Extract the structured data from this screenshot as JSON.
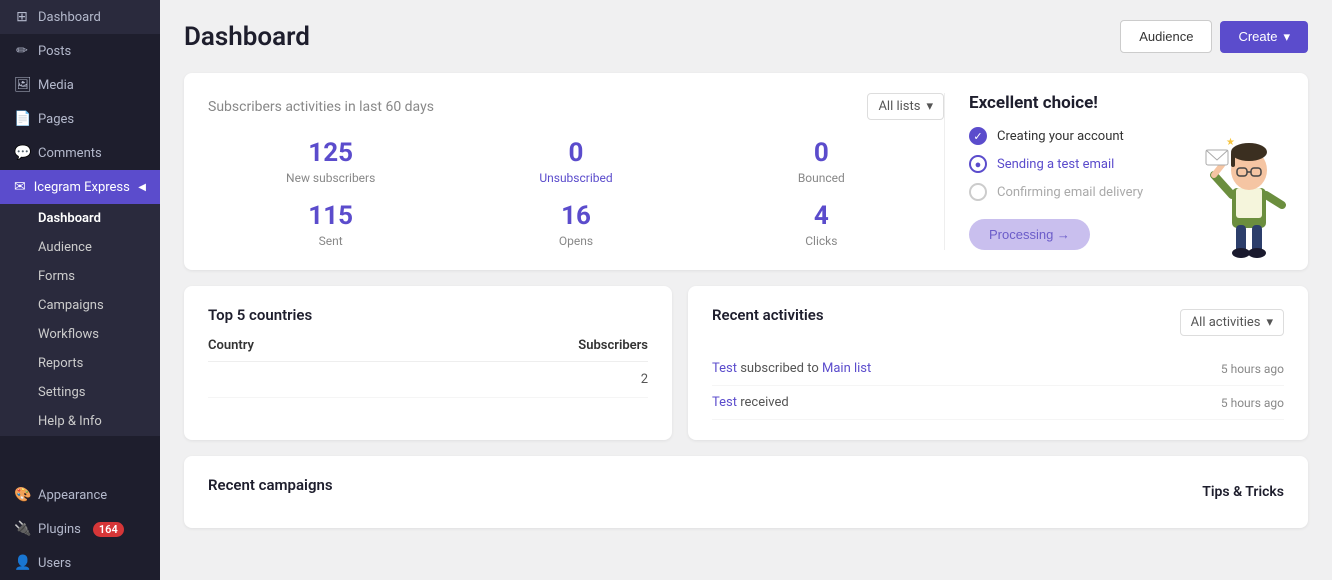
{
  "sidebar": {
    "items": [
      {
        "id": "dashboard",
        "label": "Dashboard",
        "icon": "⊞"
      },
      {
        "id": "posts",
        "label": "Posts",
        "icon": "✏"
      },
      {
        "id": "media",
        "label": "Media",
        "icon": "🖼"
      },
      {
        "id": "pages",
        "label": "Pages",
        "icon": "📄"
      },
      {
        "id": "comments",
        "label": "Comments",
        "icon": "💬"
      }
    ],
    "icegram": {
      "header_label": "Icegram Express",
      "arrow": "◀",
      "sub_items": [
        {
          "id": "dashboard-sub",
          "label": "Dashboard",
          "active": true
        },
        {
          "id": "audience",
          "label": "Audience"
        },
        {
          "id": "forms",
          "label": "Forms"
        },
        {
          "id": "campaigns",
          "label": "Campaigns"
        },
        {
          "id": "workflows",
          "label": "Workflows"
        },
        {
          "id": "reports",
          "label": "Reports"
        },
        {
          "id": "settings",
          "label": "Settings"
        },
        {
          "id": "help-info",
          "label": "Help & Info"
        }
      ]
    },
    "bottom_items": [
      {
        "id": "appearance",
        "label": "Appearance",
        "icon": "🎨"
      },
      {
        "id": "plugins",
        "label": "Plugins",
        "icon": "🔌",
        "badge": "164"
      },
      {
        "id": "users",
        "label": "Users",
        "icon": "👤"
      }
    ]
  },
  "header": {
    "title": "Dashboard",
    "audience_btn": "Audience",
    "create_btn": "Create",
    "create_arrow": "▾"
  },
  "stats_card": {
    "subtitle": "Subscribers activities in last 60 days",
    "dropdown_label": "All lists",
    "dropdown_arrow": "▾",
    "stats": [
      {
        "number": "125",
        "label": "New subscribers",
        "is_link": false
      },
      {
        "number": "0",
        "label": "Unsubscribed",
        "is_link": true
      },
      {
        "number": "0",
        "label": "Bounced",
        "is_link": false
      },
      {
        "number": "115",
        "label": "Sent",
        "is_link": false
      },
      {
        "number": "16",
        "label": "Opens",
        "is_link": false
      },
      {
        "number": "4",
        "label": "Clicks",
        "is_link": false
      }
    ]
  },
  "excellent": {
    "title": "Excellent choice!",
    "items": [
      {
        "id": "create-account",
        "label": "Creating your account",
        "status": "filled"
      },
      {
        "id": "send-test",
        "label": "Sending a test email",
        "status": "outline"
      },
      {
        "id": "confirm-delivery",
        "label": "Confirming email delivery",
        "status": "empty"
      }
    ],
    "processing_btn": "Processing →"
  },
  "top5": {
    "title": "Top 5 countries",
    "col_country": "Country",
    "col_subscribers": "Subscribers",
    "rows": [
      {
        "country": "",
        "subscribers": "2"
      }
    ]
  },
  "recent_activities": {
    "title": "Recent activities",
    "filter_label": "All activities",
    "filter_arrow": "▾",
    "rows": [
      {
        "text_parts": [
          "Test",
          " subscribed to ",
          "Main list"
        ],
        "links": [
          0,
          2
        ],
        "time": "5 hours ago"
      },
      {
        "text_parts": [
          "Test",
          " received"
        ],
        "links": [
          0
        ],
        "time": "5 hours ago"
      }
    ]
  },
  "recent_campaigns": {
    "title": "Recent campaigns",
    "tips_title": "Tips & Tricks"
  }
}
